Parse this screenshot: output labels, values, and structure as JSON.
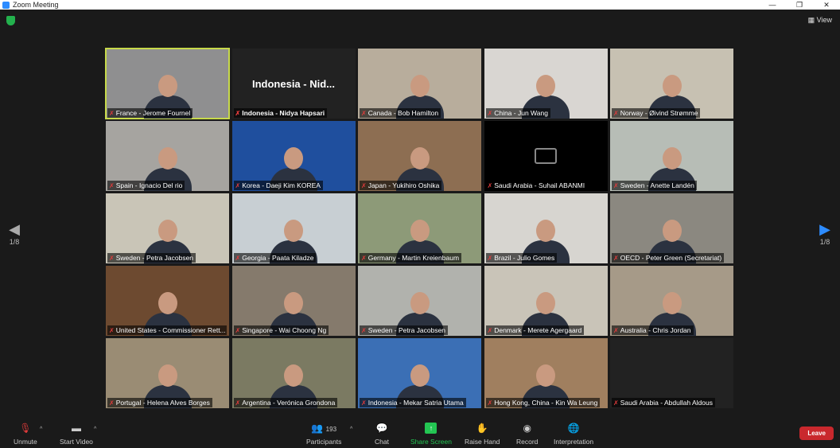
{
  "window": {
    "title": "Zoom Meeting",
    "minimize": "—",
    "maximize": "❐",
    "close": "✕"
  },
  "view_label": "View",
  "pagination": {
    "left": "1/8",
    "right": "1/8"
  },
  "tiles": [
    {
      "name": "France - Jerome Fournel",
      "bg": "#8f8f90",
      "active": true
    },
    {
      "name": "Indonesia - Nidya Hapsari",
      "bg": "#222",
      "big": "Indonesia - Nid..."
    },
    {
      "name": "Canada - Bob Hamilton",
      "bg": "#b8ad9c"
    },
    {
      "name": "China - Jun Wang",
      "bg": "#d9d6d2"
    },
    {
      "name": "Norway - Øivind Strømme",
      "bg": "#c7c1b2"
    },
    {
      "name": "Spain - Ignacio Del rio",
      "bg": "#a6a4a0"
    },
    {
      "name": "Korea - Daeji Kim KOREA",
      "bg": "#1f4f9e"
    },
    {
      "name": "Japan - Yukihiro Oshika",
      "bg": "#8d6e52"
    },
    {
      "name": "Saudi Arabia - Suhail ABANMI",
      "bg": "#000",
      "camoff": true
    },
    {
      "name": "Sweden - Anette Landén",
      "bg": "#b7bdb6"
    },
    {
      "name": "Sweden - Petra Jacobsen",
      "bg": "#c9c5b7"
    },
    {
      "name": "Georgia - Paata Kiladze",
      "bg": "#c8cfd3"
    },
    {
      "name": "Germany - Martin Kreienbaum",
      "bg": "#8d9a78"
    },
    {
      "name": "Brazil - Julio Gomes",
      "bg": "#d7d5d0"
    },
    {
      "name": "OECD - Peter Green (Secretariat)",
      "bg": "#8b8880"
    },
    {
      "name": "United States - Commissioner Rett...",
      "bg": "#6d4a30"
    },
    {
      "name": "Singapore - Wai Choong Ng",
      "bg": "#857a6c"
    },
    {
      "name": "Sweden - Petra Jacobsen",
      "bg": "#b1b2ad"
    },
    {
      "name": "Denmark - Merete Agergaard",
      "bg": "#c9c4b8"
    },
    {
      "name": "Australia - Chris Jordan",
      "bg": "#a69a88"
    },
    {
      "name": "Portugal - Helena Alves Borges",
      "bg": "#9a8c74"
    },
    {
      "name": "Argentina - Verónica Grondona",
      "bg": "#7b7a62"
    },
    {
      "name": "Indonesia - Mekar Satria Utama",
      "bg": "#3b6fb5"
    },
    {
      "name": "Hong Kong, China - Kin Wa Leung",
      "bg": "#a07f5f"
    },
    {
      "name": "Saudi Arabia - Abdullah Aldous",
      "bg": "#222",
      "empty": true
    }
  ],
  "toolbar": {
    "unmute": "Unmute",
    "start_video": "Start Video",
    "participants": "Participants",
    "participant_count": "193",
    "chat": "Chat",
    "share_screen": "Share Screen",
    "raise_hand": "Raise Hand",
    "record": "Record",
    "interpretation": "Interpretation",
    "leave": "Leave"
  },
  "colors": {
    "accent": "#2d8cff",
    "share": "#23c552",
    "leave": "#c9282d",
    "active_speaker": "#c7d94a"
  }
}
